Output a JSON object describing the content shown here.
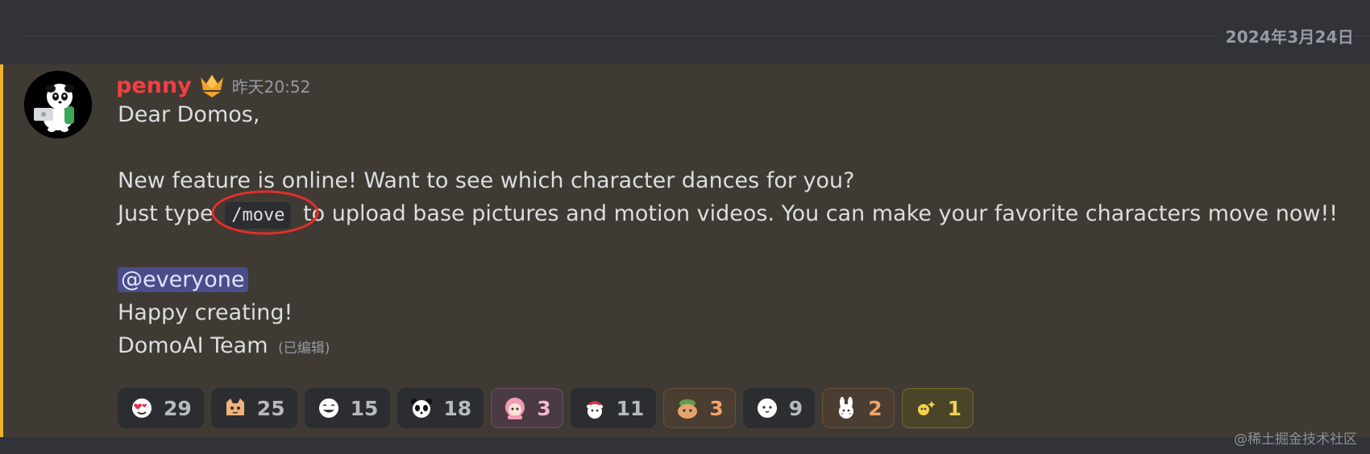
{
  "date_divider": "2024年3月24日",
  "message": {
    "username": "penny",
    "timestamp": "昨天20:52",
    "lines": {
      "greeting": "Dear Domos,",
      "announcement": "New feature is online! Want to see which character dances for you?",
      "line3_before": "Just type",
      "command": "/move",
      "line3_after": "to upload base pictures and motion videos. You can make your favorite characters move now!!",
      "mention": "@everyone",
      "closing": "Happy creating!",
      "signature": "DomoAI Team",
      "edited": "(已编辑)"
    },
    "colors": {
      "username": "#f23f42",
      "highlight_bar": "#f0b232",
      "highlight_bg": "#3f3a33",
      "annotation_circle": "#e0302a"
    }
  },
  "reactions": [
    {
      "emoji": "heart-eyes-emoji",
      "count": "29",
      "style": "default"
    },
    {
      "emoji": "cat-emoji",
      "count": "25",
      "style": "default"
    },
    {
      "emoji": "grin-emoji",
      "count": "15",
      "style": "default"
    },
    {
      "emoji": "panda-emoji",
      "count": "18",
      "style": "default"
    },
    {
      "emoji": "pink-girl-emoji",
      "count": "3",
      "style": "pink"
    },
    {
      "emoji": "santa-emoji",
      "count": "11",
      "style": "default"
    },
    {
      "emoji": "frog-hat-emoji",
      "count": "3",
      "style": "orange"
    },
    {
      "emoji": "cute-face-emoji",
      "count": "9",
      "style": "default"
    },
    {
      "emoji": "bunny-emoji",
      "count": "2",
      "style": "orange"
    },
    {
      "emoji": "spark-emoji",
      "count": "1",
      "style": "gold"
    }
  ],
  "watermark": "@稀土掘金技术社区"
}
